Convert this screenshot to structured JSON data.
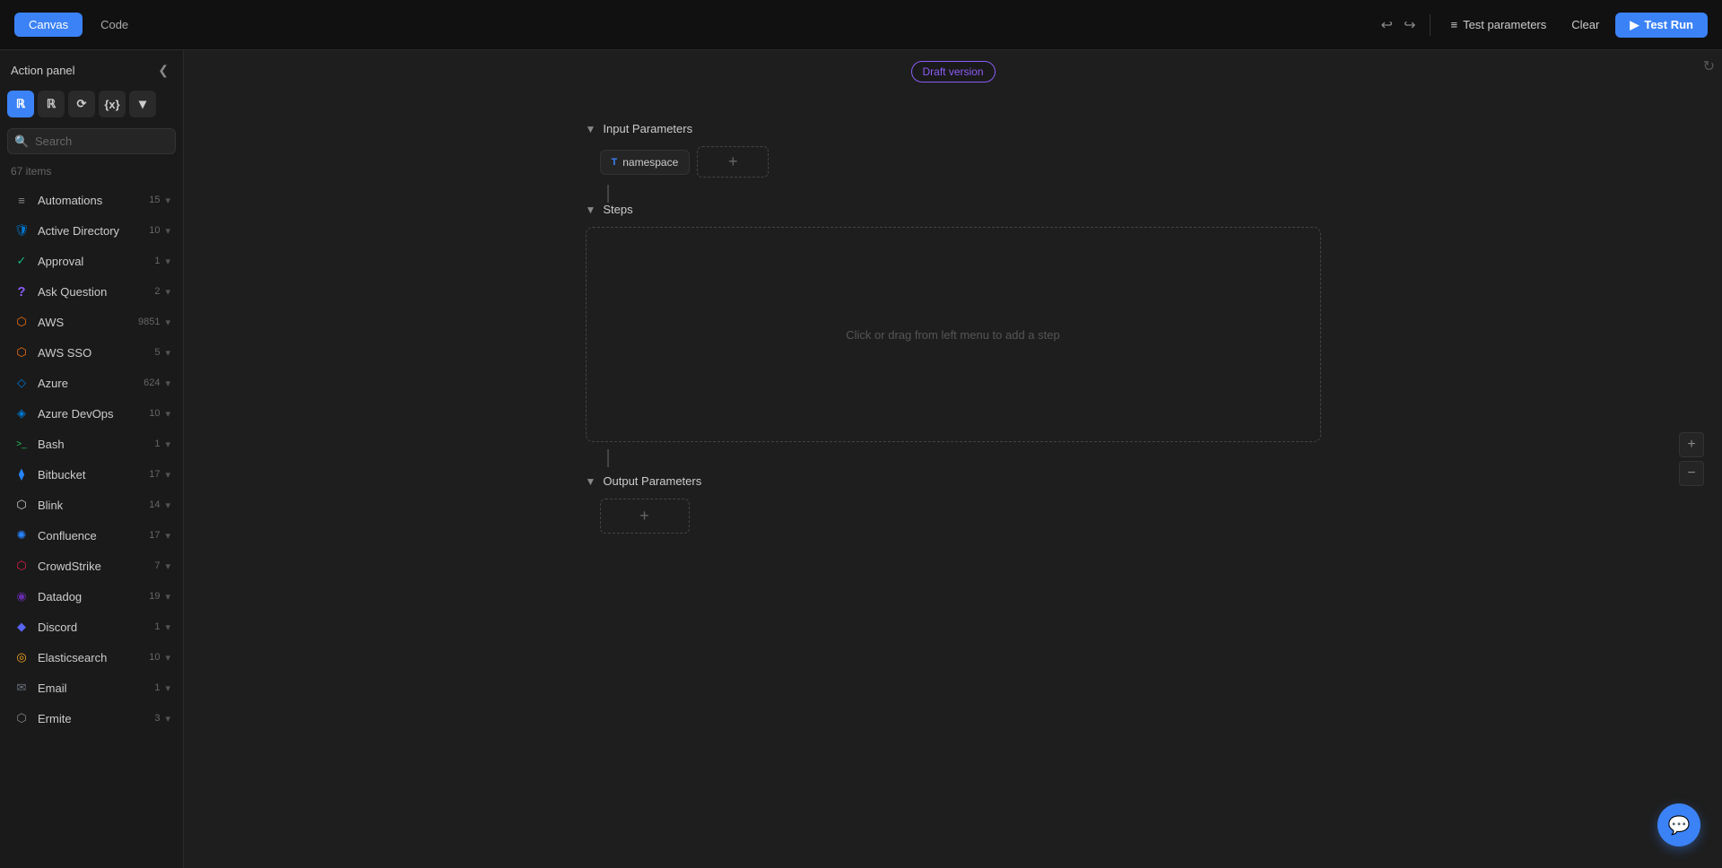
{
  "topbar": {
    "tabs": [
      {
        "id": "canvas",
        "label": "Canvas",
        "active": true
      },
      {
        "id": "code",
        "label": "Code",
        "active": false
      }
    ],
    "undo_icon": "↩",
    "redo_icon": "↪",
    "test_params_label": "Test parameters",
    "clear_label": "Clear",
    "test_run_label": "Test Run",
    "play_icon": "▶"
  },
  "sidebar": {
    "title": "Action panel",
    "collapse_icon": "❮",
    "tools": [
      {
        "id": "tool1",
        "label": "R",
        "style": "blue"
      },
      {
        "id": "tool2",
        "label": "R",
        "style": "dark"
      },
      {
        "id": "tool3",
        "label": "⟳",
        "style": "dark"
      },
      {
        "id": "tool4",
        "label": "{x}",
        "style": "dark"
      },
      {
        "id": "tool5",
        "label": "▾",
        "style": "more"
      }
    ],
    "search": {
      "placeholder": "Search",
      "icon": "🔍"
    },
    "items_count": "67 items",
    "items": [
      {
        "id": "automations",
        "name": "Automations",
        "count": 15,
        "icon": "≡",
        "icon_class": "icon-automation"
      },
      {
        "id": "active-directory",
        "name": "Active Directory",
        "count": 10,
        "icon": "🛡",
        "icon_class": "icon-ad"
      },
      {
        "id": "approval",
        "name": "Approval",
        "count": 1,
        "icon": "✓",
        "icon_class": "icon-approval"
      },
      {
        "id": "ask-question",
        "name": "Ask Question",
        "count": 2,
        "icon": "?",
        "icon_class": "icon-ask"
      },
      {
        "id": "aws",
        "name": "AWS",
        "count": 9851,
        "icon": "⬡",
        "icon_class": "icon-aws"
      },
      {
        "id": "aws-sso",
        "name": "AWS SSO",
        "count": 5,
        "icon": "⬡",
        "icon_class": "icon-aws"
      },
      {
        "id": "azure",
        "name": "Azure",
        "count": 624,
        "icon": "◇",
        "icon_class": "icon-azure"
      },
      {
        "id": "azure-devops",
        "name": "Azure DevOps",
        "count": 10,
        "icon": "◈",
        "icon_class": "icon-azure"
      },
      {
        "id": "bash",
        "name": "Bash",
        "count": 1,
        "icon": ">_",
        "icon_class": "icon-bash"
      },
      {
        "id": "bitbucket",
        "name": "Bitbucket",
        "count": 17,
        "icon": "⧫",
        "icon_class": "icon-bitbucket"
      },
      {
        "id": "blink",
        "name": "Blink",
        "count": 14,
        "icon": "⬡",
        "icon_class": "icon-blink"
      },
      {
        "id": "confluence",
        "name": "Confluence",
        "count": 17,
        "icon": "✺",
        "icon_class": "icon-confluence"
      },
      {
        "id": "crowdstrike",
        "name": "CrowdStrike",
        "count": 7,
        "icon": "⬡",
        "icon_class": "icon-crowdstrike"
      },
      {
        "id": "datadog",
        "name": "Datadog",
        "count": 19,
        "icon": "◉",
        "icon_class": "icon-datadog"
      },
      {
        "id": "discord",
        "name": "Discord",
        "count": 1,
        "icon": "◆",
        "icon_class": "icon-discord"
      },
      {
        "id": "elasticsearch",
        "name": "Elasticsearch",
        "count": 10,
        "icon": "◎",
        "icon_class": "icon-elasticsearch"
      },
      {
        "id": "email",
        "name": "Email",
        "count": 1,
        "icon": "✉",
        "icon_class": "icon-email"
      },
      {
        "id": "ermite",
        "name": "Ermite",
        "count": 3,
        "icon": "⬡",
        "icon_class": "icon-ermite"
      }
    ]
  },
  "canvas": {
    "draft_badge": "Draft version",
    "input_params_label": "Input Parameters",
    "namespace_param": "namespace",
    "namespace_type": "T",
    "add_param_icon": "+",
    "steps_label": "Steps",
    "steps_empty_text": "Click or drag from left menu to add a step",
    "output_params_label": "Output Parameters",
    "add_output_icon": "+"
  },
  "zoom": {
    "plus": "+",
    "minus": "−"
  },
  "chat": {
    "icon": "💬"
  }
}
